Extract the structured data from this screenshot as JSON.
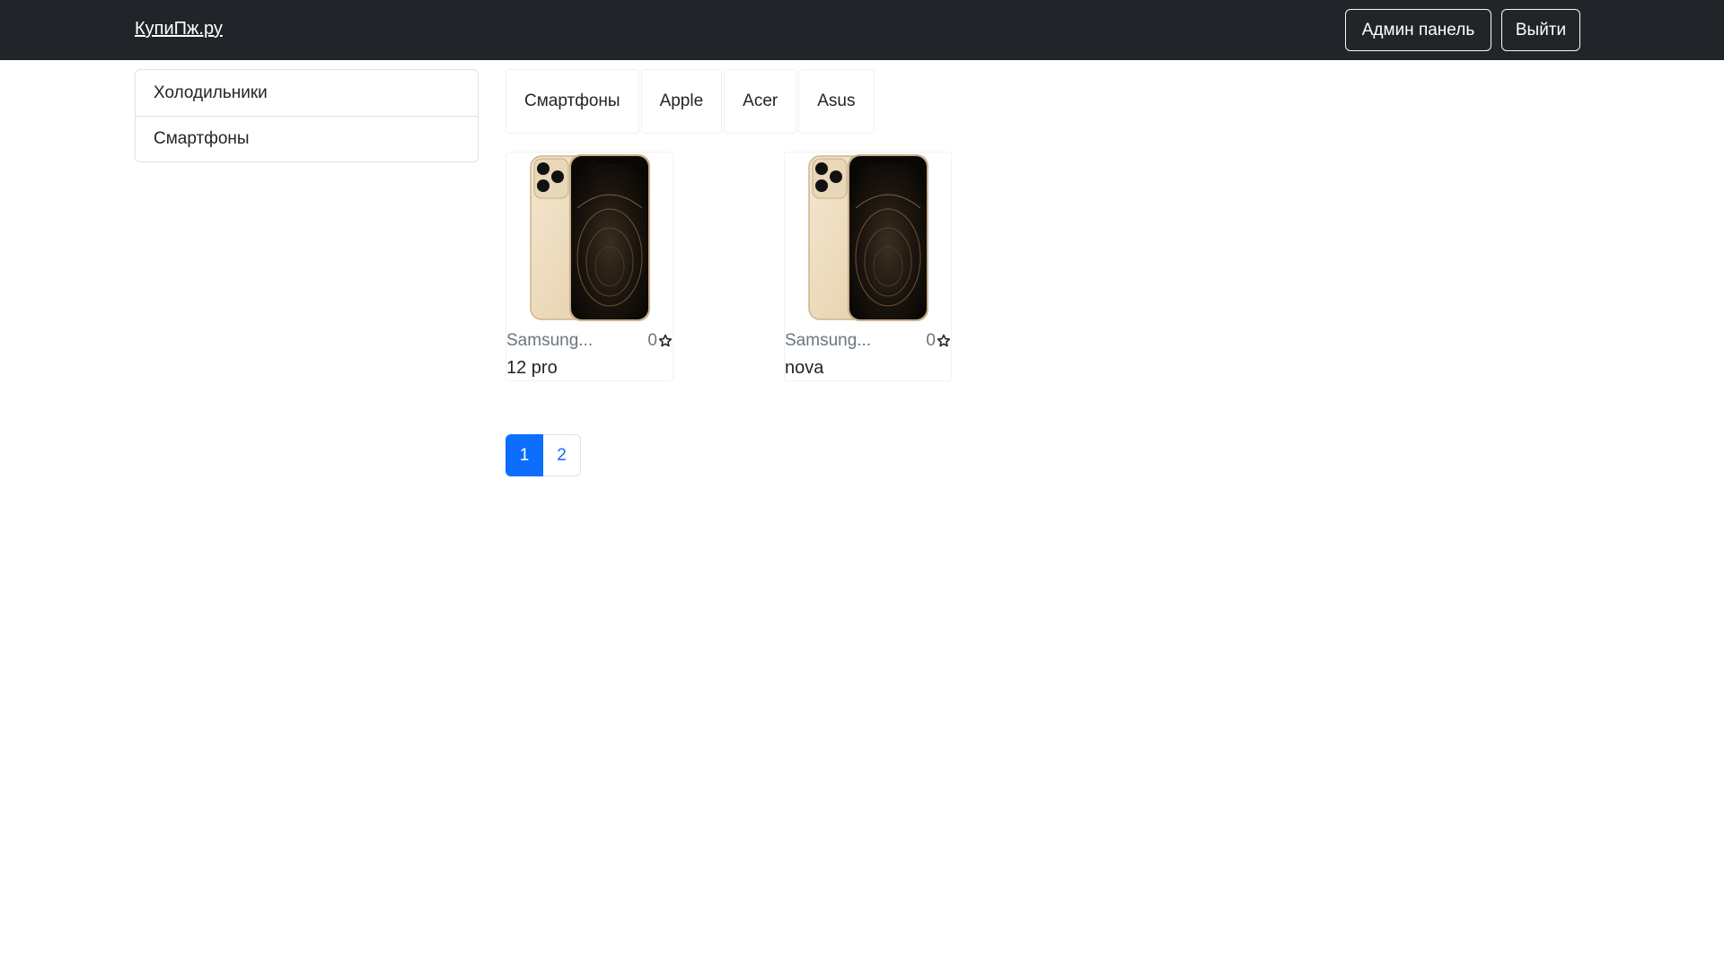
{
  "navbar": {
    "brand": "КупиПж.ру",
    "admin_label": "Админ панель",
    "logout_label": "Выйти"
  },
  "sidebar": {
    "types": [
      {
        "label": "Холодильники"
      },
      {
        "label": "Смартфоны"
      }
    ]
  },
  "brands": [
    {
      "label": "Смартфоны"
    },
    {
      "label": "Apple"
    },
    {
      "label": "Acer"
    },
    {
      "label": "Asus"
    }
  ],
  "devices": [
    {
      "brand": "Samsung...",
      "rating": "0",
      "name": "12 pro",
      "image": "iphone-12-pro-gold"
    },
    {
      "brand": "Samsung...",
      "rating": "0",
      "name": "nova",
      "image": "iphone-12-pro-gold"
    }
  ],
  "pagination": {
    "pages": [
      "1",
      "2"
    ],
    "active_page": "1"
  },
  "colors": {
    "navbar_bg": "#212529",
    "primary": "#0d6efd",
    "muted_text": "#6c757d",
    "border": "#dee2e6"
  },
  "icons": {
    "rating": "star-outline-icon"
  }
}
